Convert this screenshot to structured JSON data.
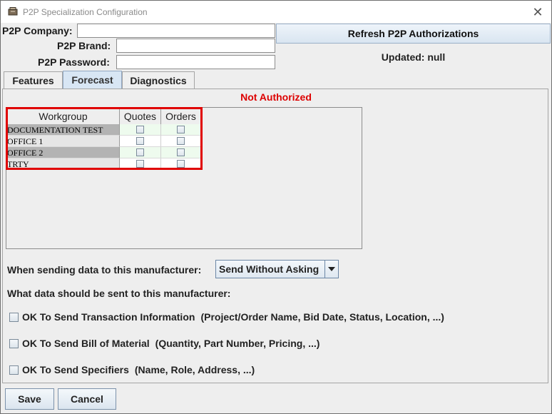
{
  "window": {
    "title": "P2P Specialization Configuration",
    "close_glyph": "✕"
  },
  "credentials": {
    "company_label": "P2P Company:",
    "company_value": "",
    "brand_label": "P2P Brand:",
    "brand_value": "",
    "password_label": "P2P Password:",
    "password_value": ""
  },
  "refresh_label": "Refresh P2P Authorizations",
  "updated_text": "Updated: null",
  "tabs": [
    {
      "label": "Features",
      "active": false
    },
    {
      "label": "Forecast",
      "active": true
    },
    {
      "label": "Diagnostics",
      "active": false
    }
  ],
  "status_text": "Not Authorized",
  "status_color": "#dd0000",
  "table": {
    "headers": {
      "workgroup": "Workgroup",
      "quotes": "Quotes",
      "orders": "Orders"
    },
    "rows": [
      {
        "name": "DOCUMENTATION TEST",
        "quotes": false,
        "orders": false
      },
      {
        "name": "OFFICE 1",
        "quotes": false,
        "orders": false
      },
      {
        "name": "OFFICE 2",
        "quotes": false,
        "orders": false
      },
      {
        "name": "TRTY",
        "quotes": false,
        "orders": false
      }
    ]
  },
  "send_label": "When sending data to this manufacturer:",
  "send_selected": "Send Without Asking",
  "what_label": "What data should be sent to this manufacturer:",
  "options": [
    {
      "title": "OK To Send Transaction Information",
      "detail": "(Project/Order Name, Bid Date, Status, Location, ...)",
      "checked": false
    },
    {
      "title": "OK To Send Bill of Material",
      "detail": "(Quantity, Part Number, Pricing, ...)",
      "checked": false
    },
    {
      "title": "OK To Send Specifiers",
      "detail": "(Name, Role, Address, ...)",
      "checked": false
    }
  ],
  "buttons": {
    "save": "Save",
    "cancel": "Cancel"
  },
  "colors": {
    "accent_tab": "#d8e6f4",
    "highlight_border": "#e00000"
  }
}
